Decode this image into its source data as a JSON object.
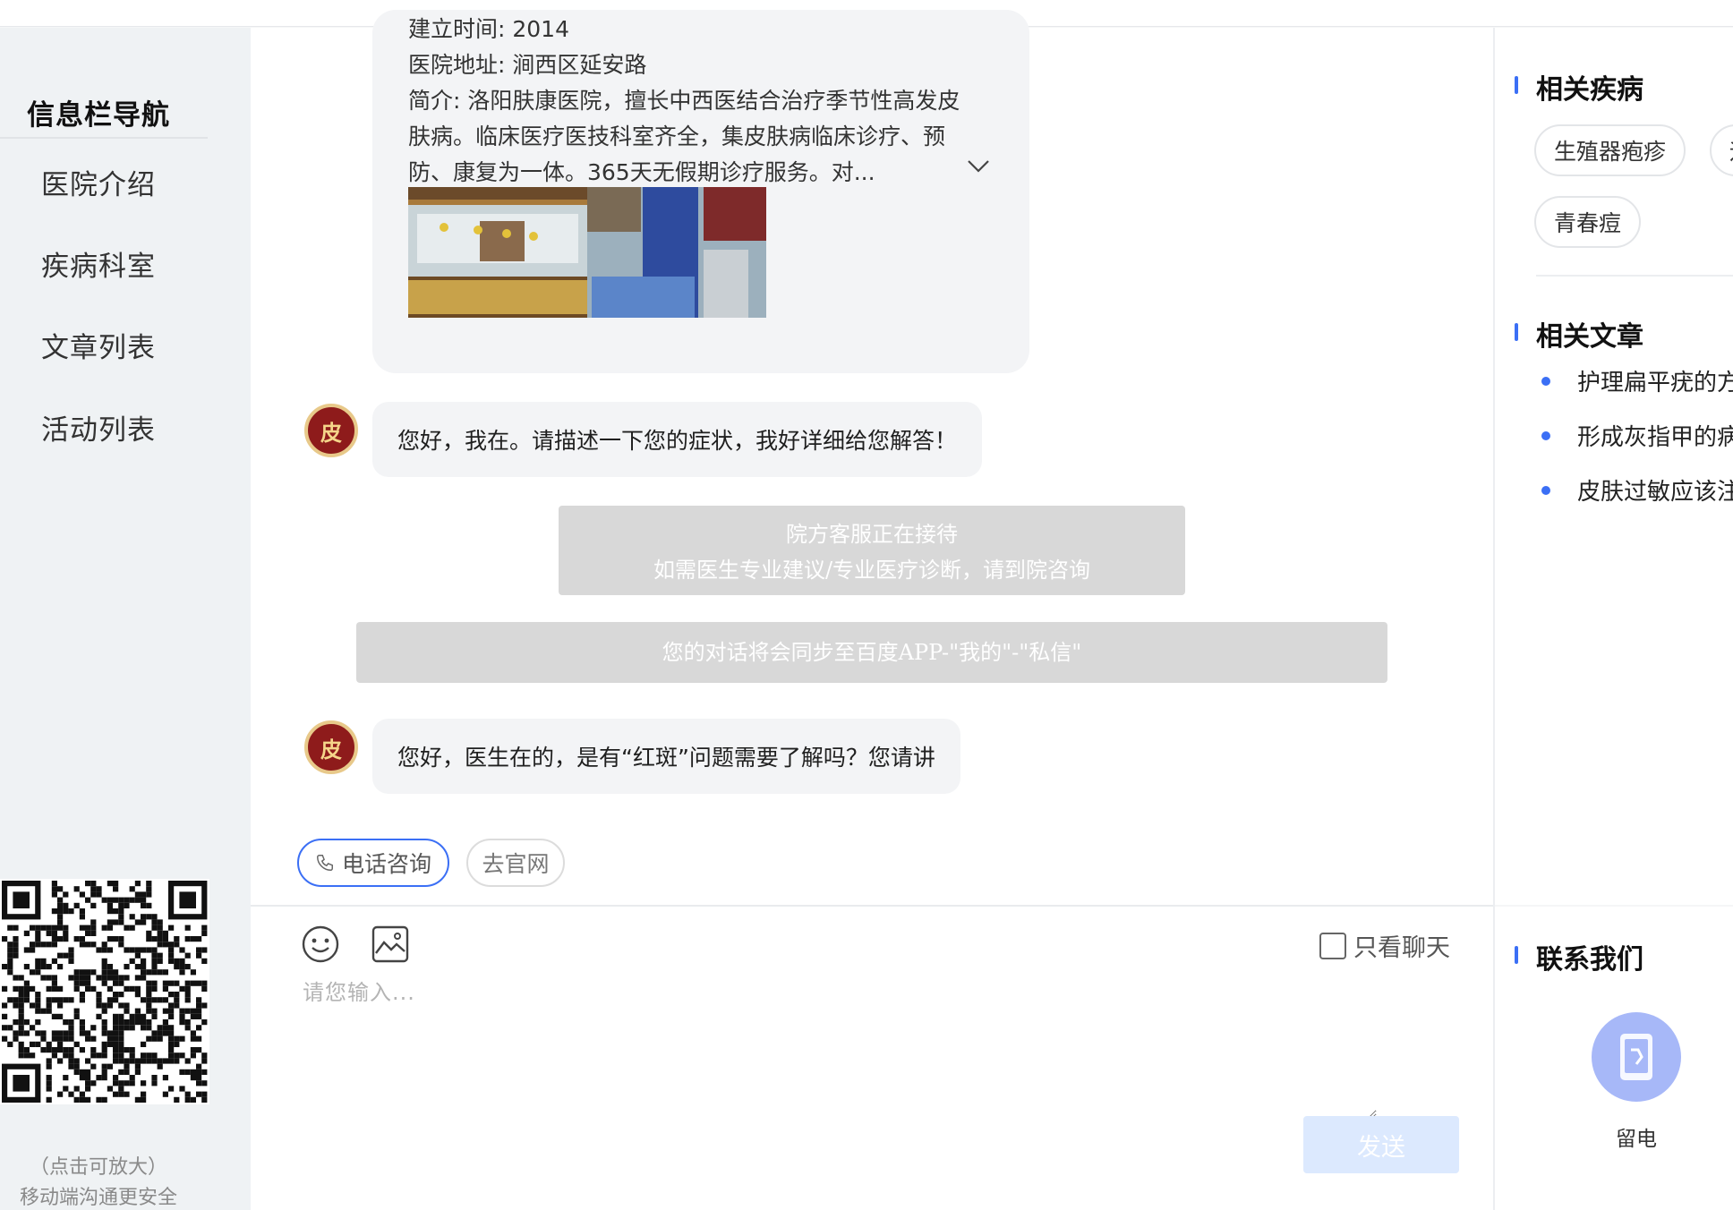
{
  "nav": {
    "title": "信息栏导航",
    "items": [
      "医院介绍",
      "疾病科室",
      "文章列表",
      "活动列表"
    ],
    "qr_hint_1": "（点击可放大）",
    "qr_hint_2": "移动端沟通更安全"
  },
  "hospital_card": {
    "founded": "建立时间: 2014",
    "address": "医院地址: 涧西区延安路",
    "intro": "简介: 洛阳肤康医院，擅长中西医结合治疗季节性高发皮肤病。临床医疗医技科室齐全，集皮肤病临床诊疗、预防、康复为一体。365天无假期诊疗服务。对..."
  },
  "chat": {
    "avatar_char": "皮",
    "msg1": "您好，我在。请描述一下您的症状，我好详细给您解答！",
    "notice_1": "院方客服正在接待",
    "notice_2": "如需医生专业建议/专业医疗诊断，请到院咨询",
    "sync_notice": "您的对话将会同步至百度APP-\"我的\"-\"私信\"",
    "msg2": "您好，医生在的，是有“红斑”问题需要了解吗？您请讲",
    "chip_phone": "电话咨询",
    "chip_site": "去官网"
  },
  "input": {
    "placeholder": "请您输入...",
    "value": "",
    "only_chat": "只看聊天",
    "send": "发送"
  },
  "right": {
    "diseases_title": "相关疾病",
    "diseases": [
      "生殖器疱疹",
      "运",
      "青春痘"
    ],
    "articles_title": "相关文章",
    "articles": [
      "护理扁平疣的方",
      "形成灰指甲的病",
      "皮肤过敏应该注"
    ],
    "contact_title": "联系我们",
    "contact_label": "留电"
  },
  "colors": {
    "accent": "#3b6ff5",
    "send_disabled": "#dce9fe",
    "phone_circle": "#a7b8f8"
  },
  "icons": [
    "phone-icon",
    "emoji-icon",
    "image-icon",
    "chevron-down-icon",
    "mobile-phone-icon",
    "qr-code"
  ]
}
